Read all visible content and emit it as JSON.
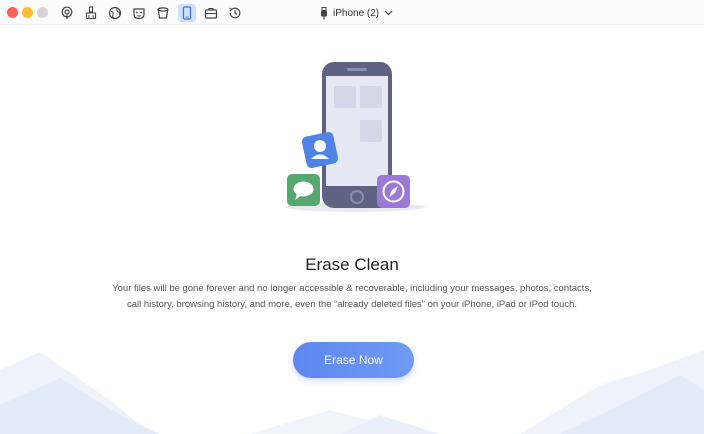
{
  "toolbar": {
    "device_name": "iPhone (2)",
    "tools": [
      {
        "name": "podcast-tool-icon"
      },
      {
        "name": "cleanup-tool-icon"
      },
      {
        "name": "globe-tool-icon"
      },
      {
        "name": "mask-tool-icon"
      },
      {
        "name": "bucket-tool-icon"
      },
      {
        "name": "phone-tool-icon",
        "active": true
      },
      {
        "name": "briefcase-tool-icon"
      },
      {
        "name": "history-tool-icon"
      }
    ]
  },
  "main": {
    "title": "Erase Clean",
    "description": "Your files will be gone forever and no longer accessible & recoverable, including your messages, photos, contacts, call history, browsing history, and more, even the “already deleted files” on your iPhone, iPad or iPod touch.",
    "button_label": "Erase Now"
  },
  "colors": {
    "accent": "#5e86f0",
    "active_tool_bg": "#cfe2fb",
    "phone_body": "#5e6384",
    "contacts_app": "#4f83e6",
    "messages_app": "#57a86f",
    "safari_app": "#9a7ad6"
  }
}
